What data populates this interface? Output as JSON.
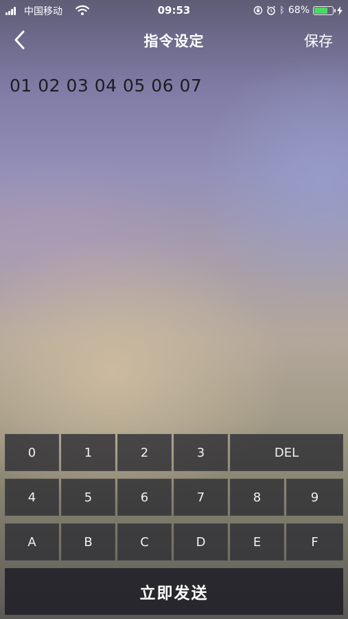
{
  "status_bar": {
    "carrier": "中国移动",
    "time": "09:53",
    "battery_percent": "68%",
    "battery_level": 0.68,
    "icons": [
      "signal-icon",
      "wifi-icon",
      "orientation-lock-icon",
      "alarm-icon",
      "bluetooth-icon",
      "battery-icon",
      "charging-icon"
    ]
  },
  "nav": {
    "title": "指令设定",
    "save_label": "保存",
    "back_icon": "chevron-left-icon"
  },
  "command": {
    "value": "01 02 03 04 05 06 07"
  },
  "keypad": {
    "row1": [
      "0",
      "1",
      "2",
      "3",
      "DEL"
    ],
    "row2": [
      "4",
      "5",
      "6",
      "7",
      "8",
      "9"
    ],
    "row3": [
      "A",
      "B",
      "C",
      "D",
      "E",
      "F"
    ],
    "send_label": "立即发送"
  },
  "colors": {
    "key_background": "#302f34",
    "send_background": "#24232a",
    "battery_fill": "#4cd964",
    "command_text": "#1c1c22"
  }
}
